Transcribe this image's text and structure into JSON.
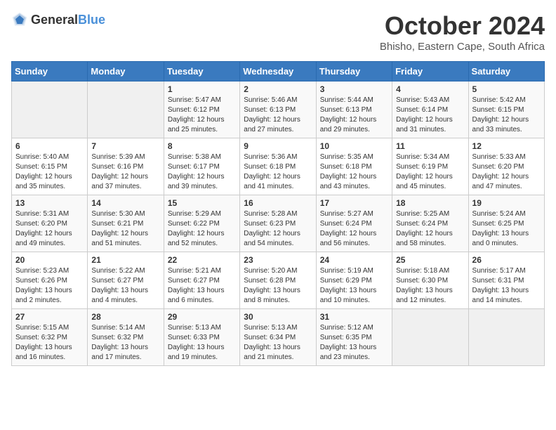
{
  "header": {
    "logo_general": "General",
    "logo_blue": "Blue",
    "month": "October 2024",
    "location": "Bhisho, Eastern Cape, South Africa"
  },
  "weekdays": [
    "Sunday",
    "Monday",
    "Tuesday",
    "Wednesday",
    "Thursday",
    "Friday",
    "Saturday"
  ],
  "weeks": [
    [
      {
        "day": "",
        "sunrise": "",
        "sunset": "",
        "daylight": ""
      },
      {
        "day": "",
        "sunrise": "",
        "sunset": "",
        "daylight": ""
      },
      {
        "day": "1",
        "sunrise": "Sunrise: 5:47 AM",
        "sunset": "Sunset: 6:12 PM",
        "daylight": "Daylight: 12 hours and 25 minutes."
      },
      {
        "day": "2",
        "sunrise": "Sunrise: 5:46 AM",
        "sunset": "Sunset: 6:13 PM",
        "daylight": "Daylight: 12 hours and 27 minutes."
      },
      {
        "day": "3",
        "sunrise": "Sunrise: 5:44 AM",
        "sunset": "Sunset: 6:13 PM",
        "daylight": "Daylight: 12 hours and 29 minutes."
      },
      {
        "day": "4",
        "sunrise": "Sunrise: 5:43 AM",
        "sunset": "Sunset: 6:14 PM",
        "daylight": "Daylight: 12 hours and 31 minutes."
      },
      {
        "day": "5",
        "sunrise": "Sunrise: 5:42 AM",
        "sunset": "Sunset: 6:15 PM",
        "daylight": "Daylight: 12 hours and 33 minutes."
      }
    ],
    [
      {
        "day": "6",
        "sunrise": "Sunrise: 5:40 AM",
        "sunset": "Sunset: 6:15 PM",
        "daylight": "Daylight: 12 hours and 35 minutes."
      },
      {
        "day": "7",
        "sunrise": "Sunrise: 5:39 AM",
        "sunset": "Sunset: 6:16 PM",
        "daylight": "Daylight: 12 hours and 37 minutes."
      },
      {
        "day": "8",
        "sunrise": "Sunrise: 5:38 AM",
        "sunset": "Sunset: 6:17 PM",
        "daylight": "Daylight: 12 hours and 39 minutes."
      },
      {
        "day": "9",
        "sunrise": "Sunrise: 5:36 AM",
        "sunset": "Sunset: 6:18 PM",
        "daylight": "Daylight: 12 hours and 41 minutes."
      },
      {
        "day": "10",
        "sunrise": "Sunrise: 5:35 AM",
        "sunset": "Sunset: 6:18 PM",
        "daylight": "Daylight: 12 hours and 43 minutes."
      },
      {
        "day": "11",
        "sunrise": "Sunrise: 5:34 AM",
        "sunset": "Sunset: 6:19 PM",
        "daylight": "Daylight: 12 hours and 45 minutes."
      },
      {
        "day": "12",
        "sunrise": "Sunrise: 5:33 AM",
        "sunset": "Sunset: 6:20 PM",
        "daylight": "Daylight: 12 hours and 47 minutes."
      }
    ],
    [
      {
        "day": "13",
        "sunrise": "Sunrise: 5:31 AM",
        "sunset": "Sunset: 6:20 PM",
        "daylight": "Daylight: 12 hours and 49 minutes."
      },
      {
        "day": "14",
        "sunrise": "Sunrise: 5:30 AM",
        "sunset": "Sunset: 6:21 PM",
        "daylight": "Daylight: 12 hours and 51 minutes."
      },
      {
        "day": "15",
        "sunrise": "Sunrise: 5:29 AM",
        "sunset": "Sunset: 6:22 PM",
        "daylight": "Daylight: 12 hours and 52 minutes."
      },
      {
        "day": "16",
        "sunrise": "Sunrise: 5:28 AM",
        "sunset": "Sunset: 6:23 PM",
        "daylight": "Daylight: 12 hours and 54 minutes."
      },
      {
        "day": "17",
        "sunrise": "Sunrise: 5:27 AM",
        "sunset": "Sunset: 6:24 PM",
        "daylight": "Daylight: 12 hours and 56 minutes."
      },
      {
        "day": "18",
        "sunrise": "Sunrise: 5:25 AM",
        "sunset": "Sunset: 6:24 PM",
        "daylight": "Daylight: 12 hours and 58 minutes."
      },
      {
        "day": "19",
        "sunrise": "Sunrise: 5:24 AM",
        "sunset": "Sunset: 6:25 PM",
        "daylight": "Daylight: 13 hours and 0 minutes."
      }
    ],
    [
      {
        "day": "20",
        "sunrise": "Sunrise: 5:23 AM",
        "sunset": "Sunset: 6:26 PM",
        "daylight": "Daylight: 13 hours and 2 minutes."
      },
      {
        "day": "21",
        "sunrise": "Sunrise: 5:22 AM",
        "sunset": "Sunset: 6:27 PM",
        "daylight": "Daylight: 13 hours and 4 minutes."
      },
      {
        "day": "22",
        "sunrise": "Sunrise: 5:21 AM",
        "sunset": "Sunset: 6:27 PM",
        "daylight": "Daylight: 13 hours and 6 minutes."
      },
      {
        "day": "23",
        "sunrise": "Sunrise: 5:20 AM",
        "sunset": "Sunset: 6:28 PM",
        "daylight": "Daylight: 13 hours and 8 minutes."
      },
      {
        "day": "24",
        "sunrise": "Sunrise: 5:19 AM",
        "sunset": "Sunset: 6:29 PM",
        "daylight": "Daylight: 13 hours and 10 minutes."
      },
      {
        "day": "25",
        "sunrise": "Sunrise: 5:18 AM",
        "sunset": "Sunset: 6:30 PM",
        "daylight": "Daylight: 13 hours and 12 minutes."
      },
      {
        "day": "26",
        "sunrise": "Sunrise: 5:17 AM",
        "sunset": "Sunset: 6:31 PM",
        "daylight": "Daylight: 13 hours and 14 minutes."
      }
    ],
    [
      {
        "day": "27",
        "sunrise": "Sunrise: 5:15 AM",
        "sunset": "Sunset: 6:32 PM",
        "daylight": "Daylight: 13 hours and 16 minutes."
      },
      {
        "day": "28",
        "sunrise": "Sunrise: 5:14 AM",
        "sunset": "Sunset: 6:32 PM",
        "daylight": "Daylight: 13 hours and 17 minutes."
      },
      {
        "day": "29",
        "sunrise": "Sunrise: 5:13 AM",
        "sunset": "Sunset: 6:33 PM",
        "daylight": "Daylight: 13 hours and 19 minutes."
      },
      {
        "day": "30",
        "sunrise": "Sunrise: 5:13 AM",
        "sunset": "Sunset: 6:34 PM",
        "daylight": "Daylight: 13 hours and 21 minutes."
      },
      {
        "day": "31",
        "sunrise": "Sunrise: 5:12 AM",
        "sunset": "Sunset: 6:35 PM",
        "daylight": "Daylight: 13 hours and 23 minutes."
      },
      {
        "day": "",
        "sunrise": "",
        "sunset": "",
        "daylight": ""
      },
      {
        "day": "",
        "sunrise": "",
        "sunset": "",
        "daylight": ""
      }
    ]
  ]
}
